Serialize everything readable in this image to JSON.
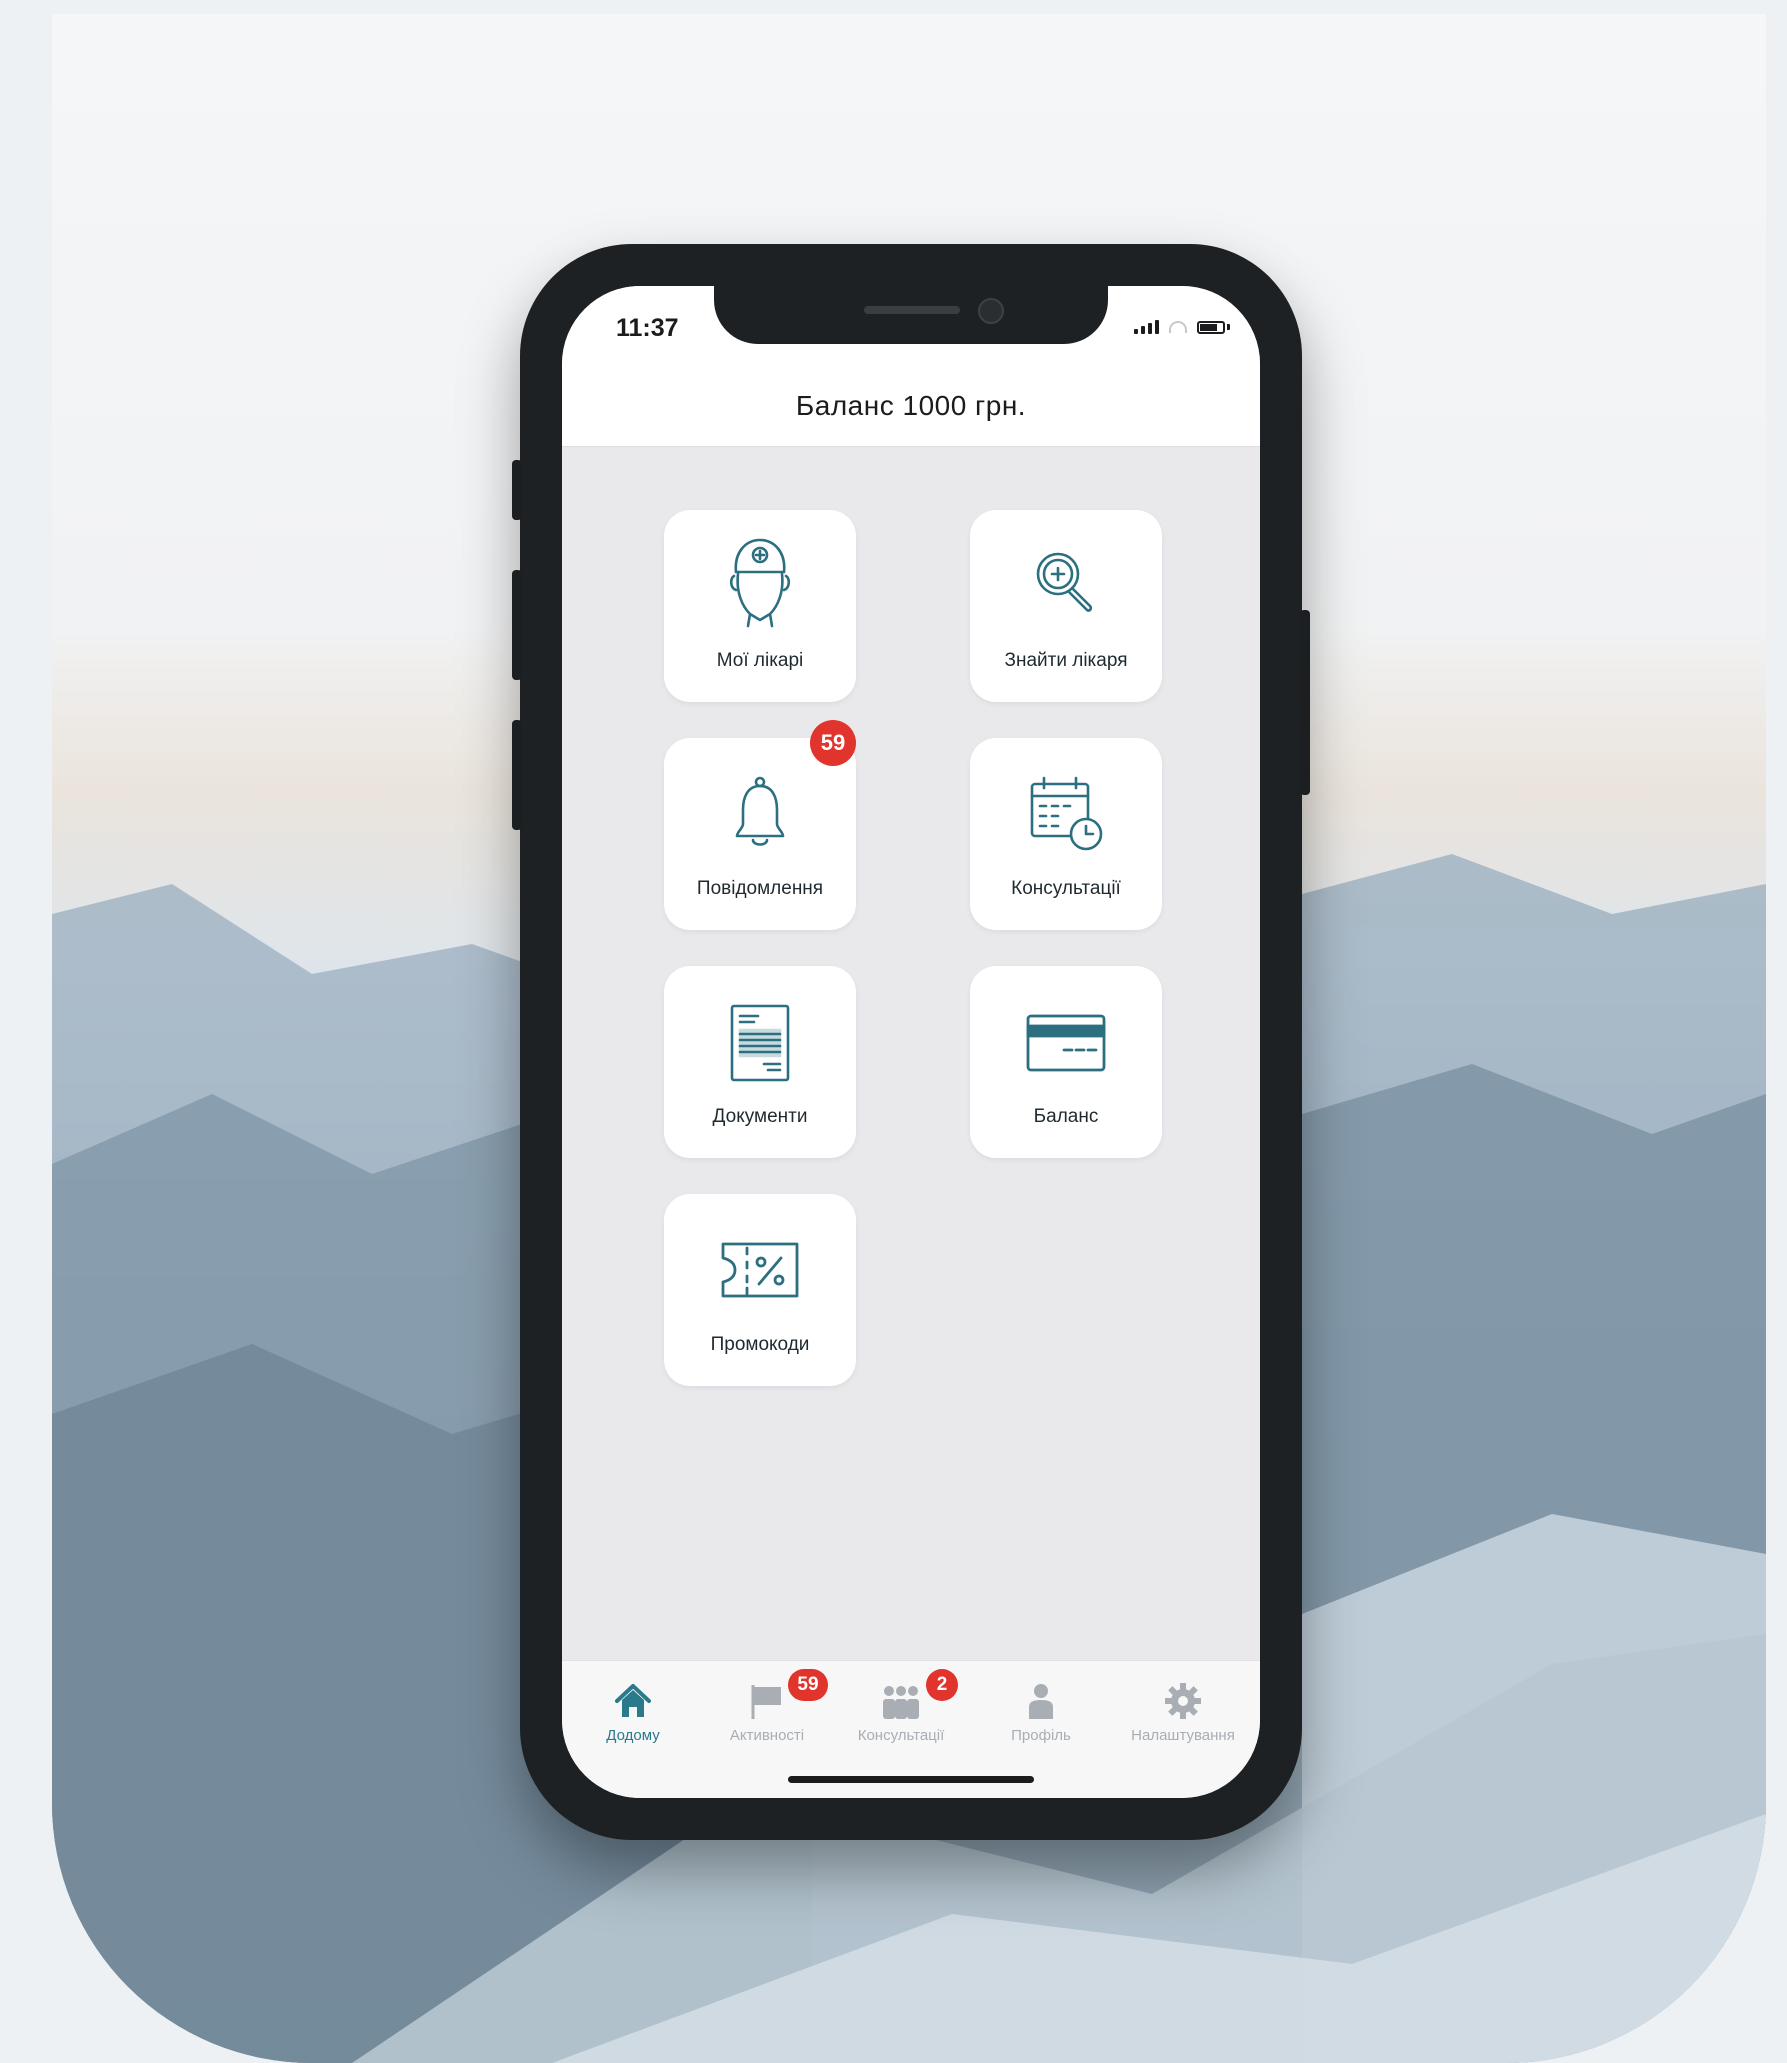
{
  "status_bar": {
    "time": "11:37"
  },
  "header": {
    "title": "Баланс 1000 грн."
  },
  "tiles": [
    {
      "label": "Мої лікарі",
      "icon": "doctor-icon"
    },
    {
      "label": "Знайти лікаря",
      "icon": "search-doctor-icon"
    },
    {
      "label": "Повідомлення",
      "icon": "bell-icon",
      "badge": "59"
    },
    {
      "label": "Консультації",
      "icon": "calendar-clock-icon"
    },
    {
      "label": "Документи",
      "icon": "document-icon"
    },
    {
      "label": "Баланс",
      "icon": "credit-card-icon"
    },
    {
      "label": "Промокоди",
      "icon": "coupon-percent-icon"
    }
  ],
  "tabbar": {
    "items": [
      {
        "label": "Додому",
        "icon": "home-icon",
        "active": true
      },
      {
        "label": "Активності",
        "icon": "flag-icon",
        "badge": "59"
      },
      {
        "label": "Консультації",
        "icon": "group-icon",
        "badge": "2"
      },
      {
        "label": "Профіль",
        "icon": "person-icon"
      },
      {
        "label": "Налаштування",
        "icon": "gear-icon"
      }
    ]
  },
  "colors": {
    "accent": "#2a7a8c",
    "badge": "#e0342c",
    "icon_stroke": "#2b6f80",
    "screen_background": "#e9e9ec"
  }
}
